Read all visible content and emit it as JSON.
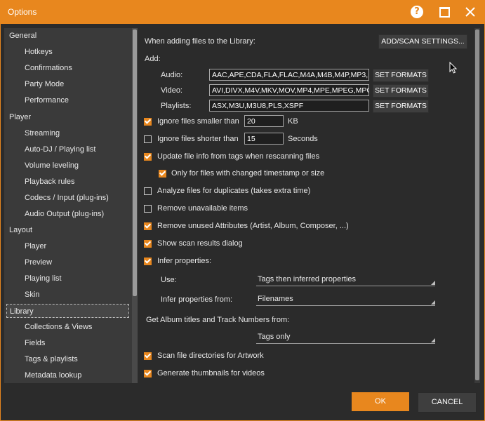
{
  "window": {
    "title": "Options",
    "help_glyph": "?",
    "accent": "#e8871e"
  },
  "sidebar": {
    "items": [
      {
        "label": "General",
        "kind": "category"
      },
      {
        "label": "Hotkeys",
        "kind": "sub"
      },
      {
        "label": "Confirmations",
        "kind": "sub"
      },
      {
        "label": "Party Mode",
        "kind": "sub"
      },
      {
        "label": "Performance",
        "kind": "sub"
      },
      {
        "label": "Player",
        "kind": "category"
      },
      {
        "label": "Streaming",
        "kind": "sub"
      },
      {
        "label": "Auto-DJ / Playing list",
        "kind": "sub"
      },
      {
        "label": "Volume leveling",
        "kind": "sub"
      },
      {
        "label": "Playback rules",
        "kind": "sub"
      },
      {
        "label": "Codecs / Input (plug-ins)",
        "kind": "sub"
      },
      {
        "label": "Audio Output (plug-ins)",
        "kind": "sub"
      },
      {
        "label": "Layout",
        "kind": "category"
      },
      {
        "label": "Player",
        "kind": "sub"
      },
      {
        "label": "Preview",
        "kind": "sub"
      },
      {
        "label": "Playing list",
        "kind": "sub"
      },
      {
        "label": "Skin",
        "kind": "sub"
      },
      {
        "label": "Library",
        "kind": "category",
        "selected": true
      },
      {
        "label": "Collections & Views",
        "kind": "sub"
      },
      {
        "label": "Fields",
        "kind": "sub"
      },
      {
        "label": "Tags & playlists",
        "kind": "sub"
      },
      {
        "label": "Metadata lookup",
        "kind": "sub"
      }
    ]
  },
  "main": {
    "adding_header": "When adding files to the Library:",
    "add_scan_button": "ADD/SCAN SETTINGS...",
    "add_label": "Add:",
    "audio_label": "Audio:",
    "audio_value": "AAC,APE,CDA,FLA,FLAC,M4A,M4B,M4P,MP3,MP",
    "video_label": "Video:",
    "video_value": "AVI,DIVX,M4V,MKV,MOV,MP4,MPE,MPEG,MPG,",
    "playlists_label": "Playlists:",
    "playlists_value": "ASX,M3U,M3U8,PLS,XSPF",
    "set_formats": "SET FORMATS",
    "ignore_smaller_label": "Ignore files smaller than",
    "ignore_smaller_value": "20",
    "ignore_smaller_unit": "KB",
    "ignore_shorter_label": "Ignore files shorter than",
    "ignore_shorter_value": "15",
    "ignore_shorter_unit": "Seconds",
    "update_tags": "Update file info from tags when rescanning files",
    "only_changed": "Only for files with changed timestamp or size",
    "analyze_dupes": "Analyze files for duplicates (takes extra time)",
    "remove_unavailable": "Remove unavailable items",
    "remove_unused": "Remove unused Attributes (Artist, Album, Composer, ...)",
    "show_scan": "Show scan results dialog",
    "infer_props": "Infer properties:",
    "use_label": "Use:",
    "use_value": "Tags then inferred properties",
    "infer_from_label": "Infer properties from:",
    "infer_from_value": "Filenames",
    "album_titles_label": "Get Album titles and Track Numbers from:",
    "album_titles_value": "Tags only",
    "scan_artwork": "Scan file directories for Artwork",
    "gen_thumbs": "Generate thumbnails for videos",
    "checks": {
      "ignore_smaller": true,
      "ignore_shorter": false,
      "update_tags": true,
      "only_changed": true,
      "analyze_dupes": false,
      "remove_unavailable": false,
      "remove_unused": true,
      "show_scan": true,
      "infer_props": true,
      "scan_artwork": true,
      "gen_thumbs": true
    }
  },
  "footer": {
    "ok": "OK",
    "cancel": "CANCEL"
  }
}
